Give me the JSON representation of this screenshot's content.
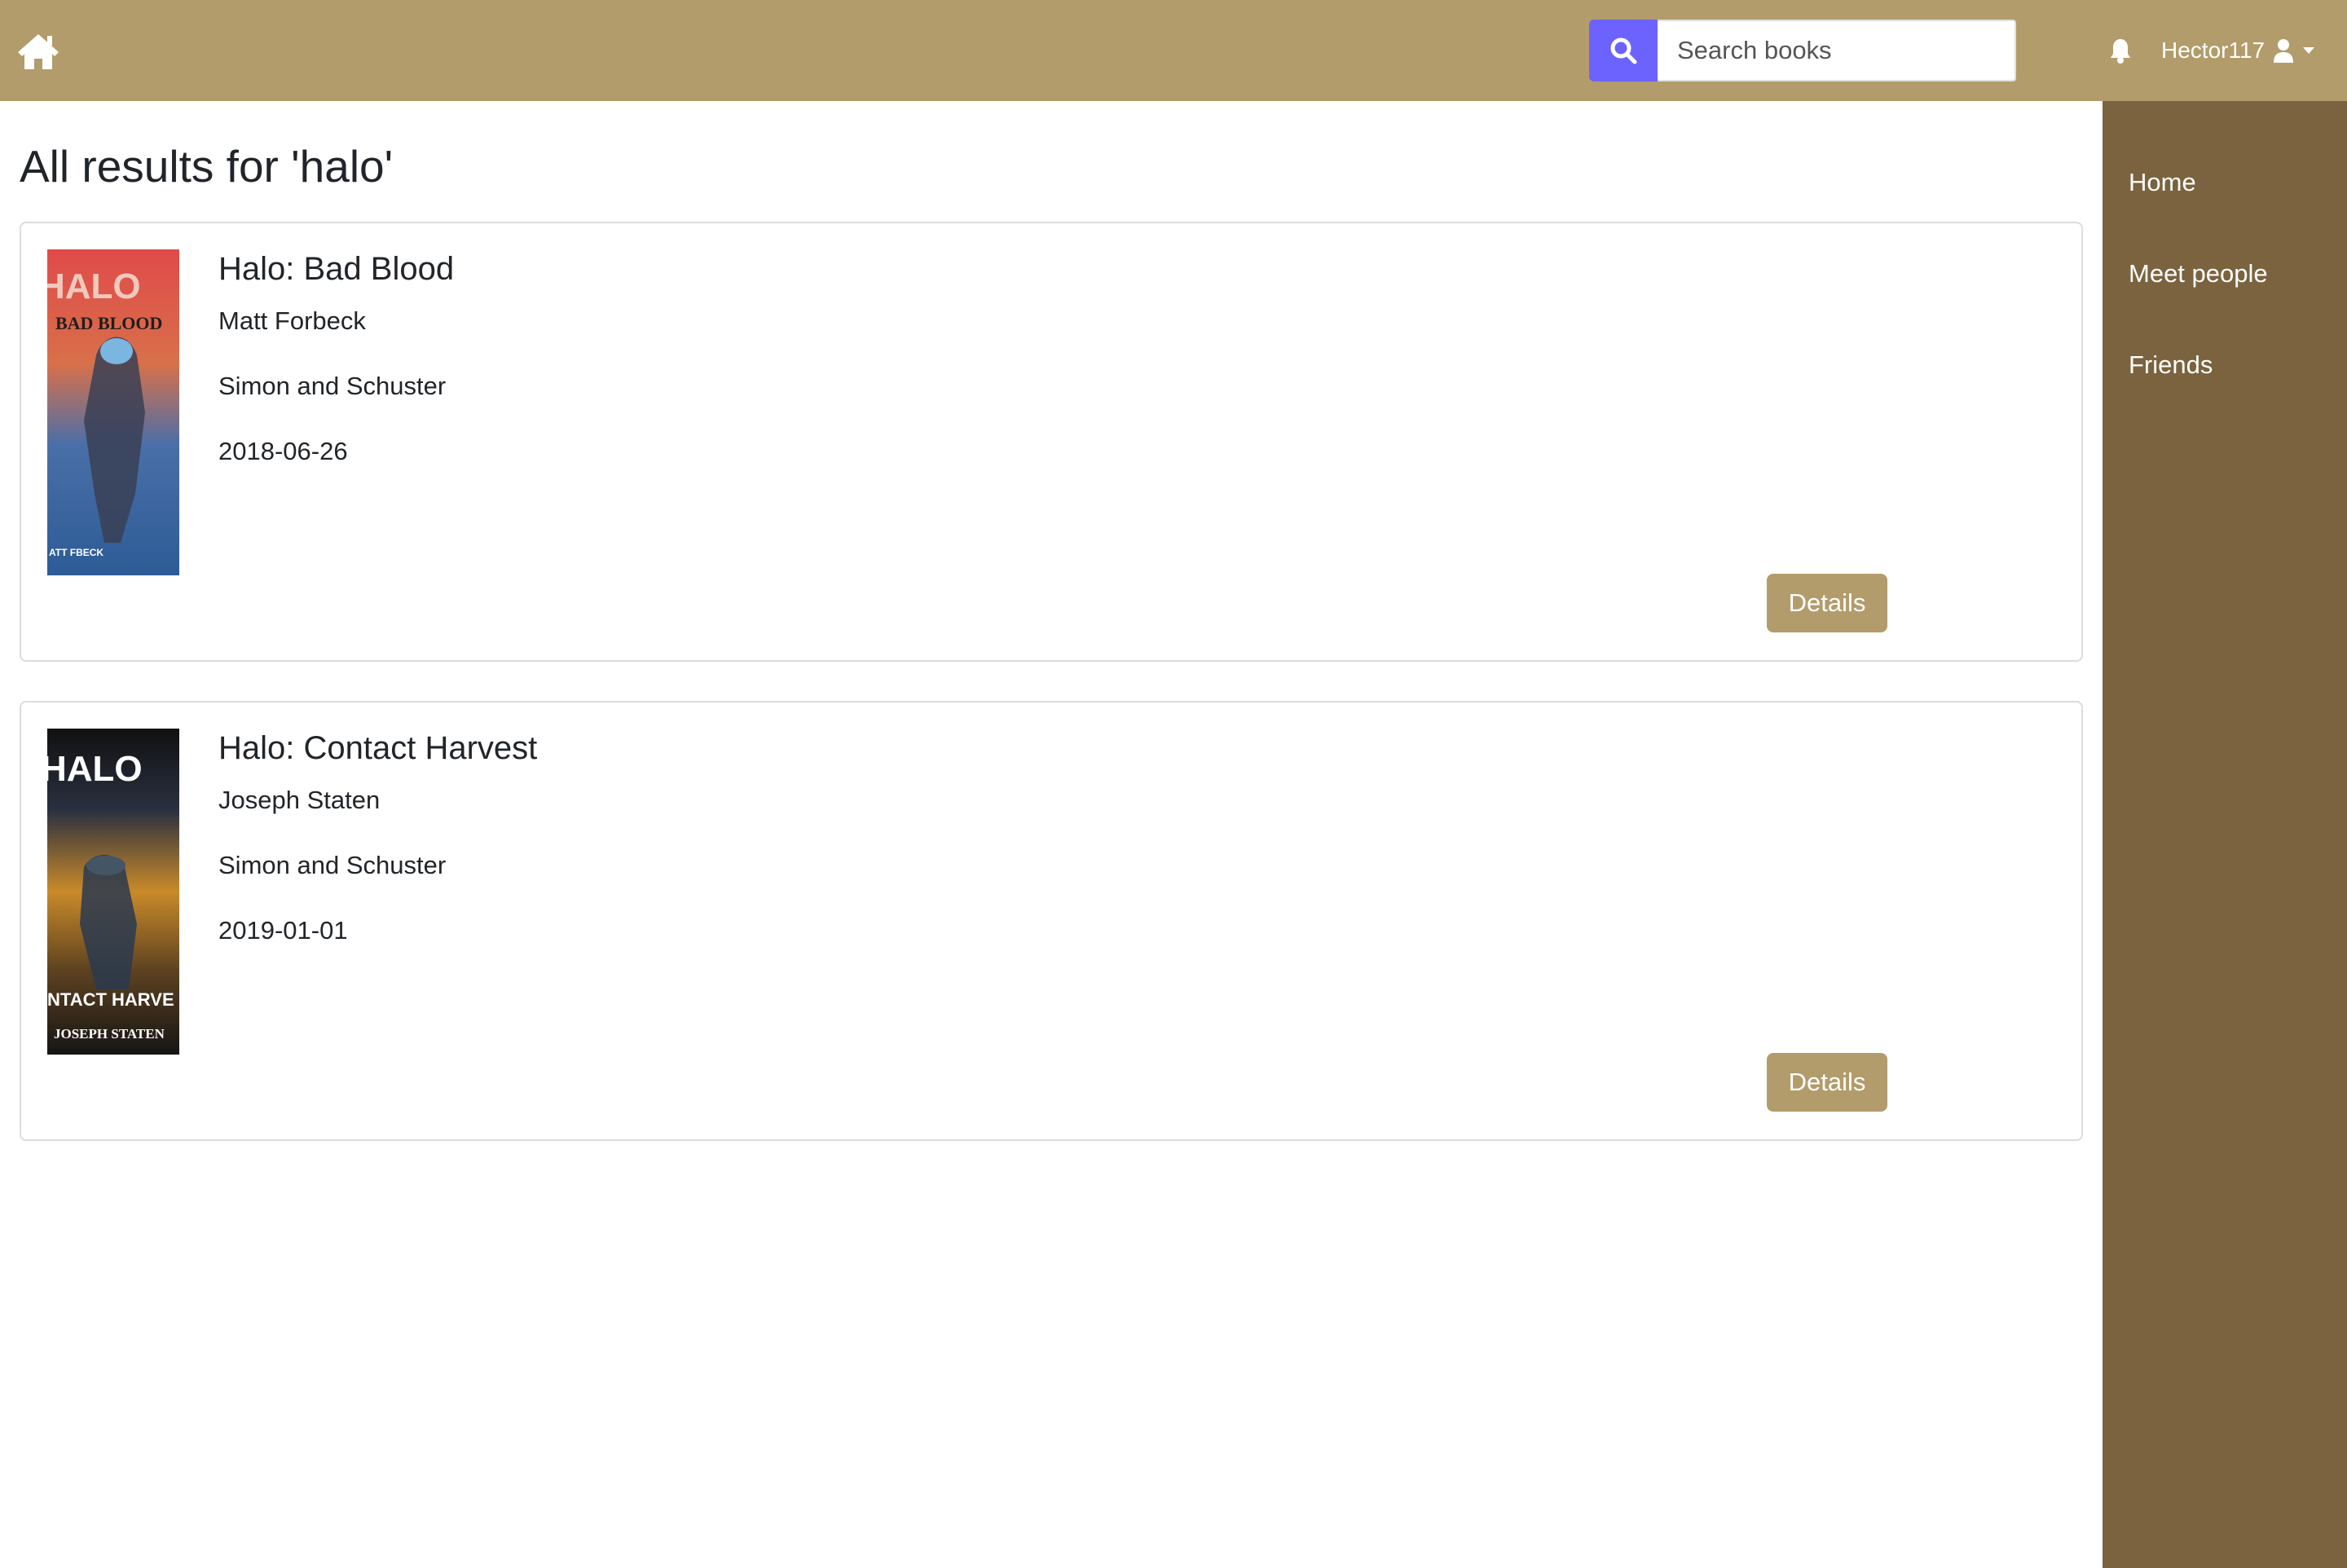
{
  "header": {
    "search_placeholder": "Search books",
    "username": "Hector117"
  },
  "sidebar": {
    "items": [
      {
        "label": "Home"
      },
      {
        "label": "Meet people"
      },
      {
        "label": "Friends"
      }
    ]
  },
  "main": {
    "title": "All results for 'halo'",
    "results": [
      {
        "title": "Halo: Bad Blood",
        "author": "Matt Forbeck",
        "publisher": "Simon and Schuster",
        "date": "2018-06-26",
        "button_label": "Details",
        "cover": {
          "series": "HALO",
          "subtitle": "BAD BLOOD",
          "author_fragment": "ATT FBECK"
        }
      },
      {
        "title": "Halo: Contact Harvest",
        "author": "Joseph Staten",
        "publisher": "Simon and Schuster",
        "date": "2019-01-01",
        "button_label": "Details",
        "cover": {
          "series": "HALO",
          "subtitle": "NTACT HARVE",
          "author_fragment": "JOSEPH STATEN"
        }
      }
    ]
  },
  "colors": {
    "header": "#b29c6b",
    "sidebar": "#7a633e",
    "search_button": "#6c63ff",
    "details_button": "#b29c6b"
  }
}
